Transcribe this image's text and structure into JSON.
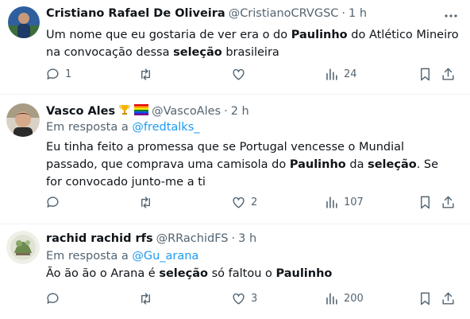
{
  "tweets": [
    {
      "name": "Cristiano Rafael De Oliveira",
      "handle": "@CristianoCRVGSC",
      "separator": "·",
      "time": "1 h",
      "text_parts": [
        {
          "t": "Um nome que eu gostaria de ver era o do ",
          "b": false
        },
        {
          "t": "Paulinho",
          "b": true
        },
        {
          "t": " do Atlético Mineiro na convocação dessa ",
          "b": false
        },
        {
          "t": "seleção",
          "b": true
        },
        {
          "t": " brasileira",
          "b": false
        }
      ],
      "replies": "1",
      "retweets": "",
      "likes": "",
      "views": "24"
    },
    {
      "name": "Vasco Ales",
      "badges": [
        "trophy-emoji",
        "rainbow-flag-emoji"
      ],
      "handle": "@VascoAles",
      "separator": "·",
      "time": "2 h",
      "reply_prefix": "Em resposta a ",
      "reply_to": "@fredtalks_",
      "text_parts": [
        {
          "t": "Eu tinha feito a promessa que se Portugal vencesse o Mundial passado, que comprava uma camisola do ",
          "b": false
        },
        {
          "t": "Paulinho",
          "b": true
        },
        {
          "t": " da ",
          "b": false
        },
        {
          "t": "seleção",
          "b": true
        },
        {
          "t": ". Se for convocado junto-me a ti",
          "b": false
        }
      ],
      "replies": "",
      "retweets": "",
      "likes": "2",
      "views": "107"
    },
    {
      "name": "rachid rachid rfs",
      "handle": "@RRachidFS",
      "separator": "·",
      "time": "3 h",
      "reply_prefix": "Em resposta a ",
      "reply_to": "@Gu_arana",
      "text_parts": [
        {
          "t": "Ão ão ão o Arana é ",
          "b": false
        },
        {
          "t": "seleção",
          "b": true
        },
        {
          "t": " só faltou o ",
          "b": false
        },
        {
          "t": "Paulinho",
          "b": true
        }
      ],
      "replies": "",
      "retweets": "",
      "likes": "3",
      "views": "200"
    }
  ],
  "colors": {
    "text": "#0f1419",
    "secondary": "#536471",
    "link": "#1d9bf0",
    "divider": "#eff3f4"
  }
}
